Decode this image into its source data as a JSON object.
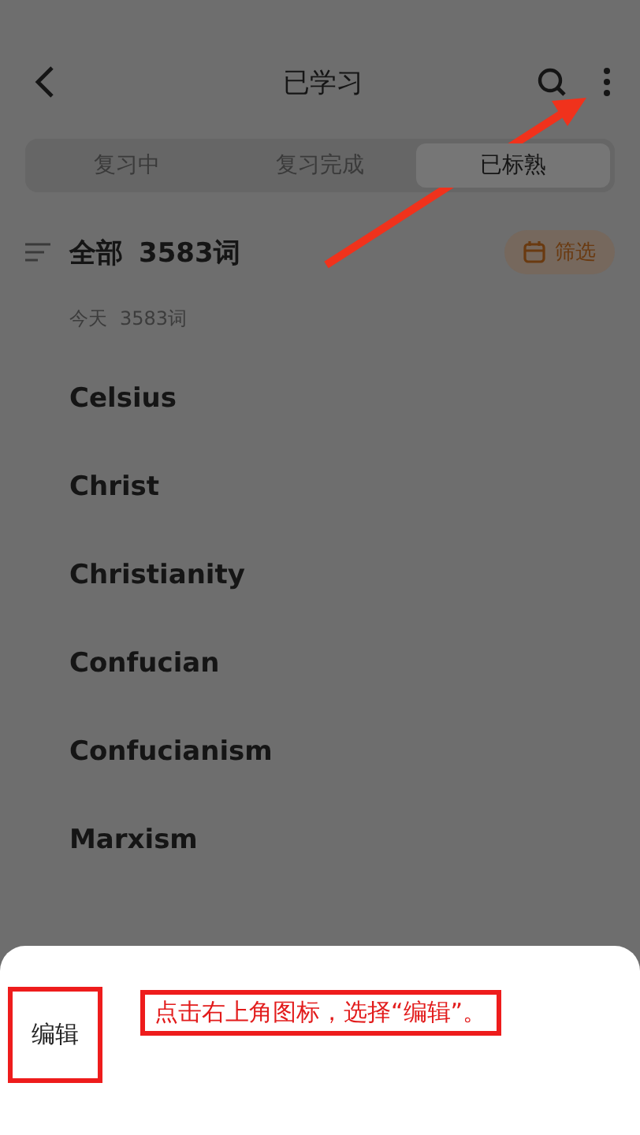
{
  "header": {
    "title": "已学习"
  },
  "tabs": [
    {
      "label": "复习中",
      "selected": false
    },
    {
      "label": "复习完成",
      "selected": false
    },
    {
      "label": "已标熟",
      "selected": true
    }
  ],
  "summary": {
    "title": "全部",
    "count": "3583词",
    "filter": "筛选"
  },
  "group": {
    "label": "今天",
    "count": "3583词"
  },
  "words": [
    "Celsius",
    "Christ",
    "Christianity",
    "Confucian",
    "Confucianism",
    "Marxism"
  ],
  "sheet": {
    "items": [
      {
        "label": "编辑",
        "annotated": true
      }
    ]
  },
  "annotation": {
    "text": "点击右上角图标，选择“编辑”。"
  }
}
